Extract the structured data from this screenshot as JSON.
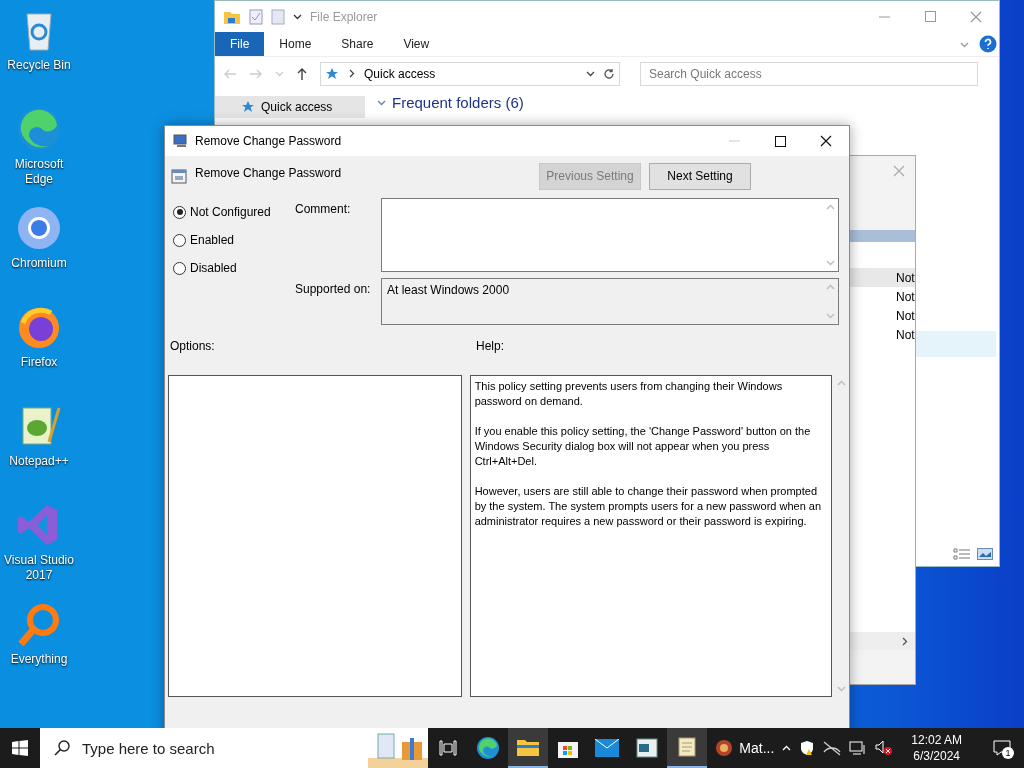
{
  "desktop_icons": [
    {
      "label": "Recycle Bin",
      "kind": "bin"
    },
    {
      "label": "Microsoft Edge",
      "kind": "edge"
    },
    {
      "label": "Chromium",
      "kind": "chromium"
    },
    {
      "label": "Firefox",
      "kind": "firefox"
    },
    {
      "label": "Notepad++",
      "kind": "notepad"
    },
    {
      "label": "Visual Studio 2017",
      "kind": "vs"
    },
    {
      "label": "Everything",
      "kind": "everything"
    }
  ],
  "file_explorer": {
    "title": "File Explorer",
    "ribbon_tabs": [
      {
        "label": "File",
        "selected": true
      },
      {
        "label": "Home",
        "selected": false
      },
      {
        "label": "Share",
        "selected": false
      },
      {
        "label": "View",
        "selected": false
      }
    ],
    "address": "Quick access",
    "search": {
      "placeholder": "Search Quick access"
    },
    "nav_item": "Quick access",
    "section": "Frequent folders (6)"
  },
  "background_window": {
    "rows": [
      {
        "text": "Not",
        "selected": true
      },
      {
        "text": "Not",
        "selected": false
      },
      {
        "text": "Not",
        "selected": false
      },
      {
        "text": "Not",
        "selected": false
      }
    ]
  },
  "dialog": {
    "title": "Remove Change Password",
    "setting_name": "Remove Change Password",
    "buttons": [
      {
        "label": "Previous Setting",
        "disabled": true
      },
      {
        "label": "Next Setting",
        "disabled": false
      }
    ],
    "radios": [
      {
        "label": "Not Configured",
        "selected": true
      },
      {
        "label": "Enabled",
        "selected": false
      },
      {
        "label": "Disabled",
        "selected": false
      }
    ],
    "comment_label": "Comment:",
    "supported_label": "Supported on:",
    "supported_value": "At least Windows 2000",
    "options_label": "Options:",
    "help_label": "Help:",
    "help_paragraphs": [
      "This policy setting prevents users from changing their Windows password on demand.",
      "If you enable this policy setting,  the 'Change Password' button on the Windows Security dialog box will not appear when you press Ctrl+Alt+Del.",
      "However, users are still able to change their password when prompted by the system. The system prompts users for a new password when an administrator requires a new password or their password is expiring."
    ]
  },
  "taskbar": {
    "search": {
      "placeholder": "Type here to search"
    },
    "running_app": "Mat...",
    "time": "12:02 AM",
    "date": "6/3/2024",
    "notifications": "1"
  }
}
